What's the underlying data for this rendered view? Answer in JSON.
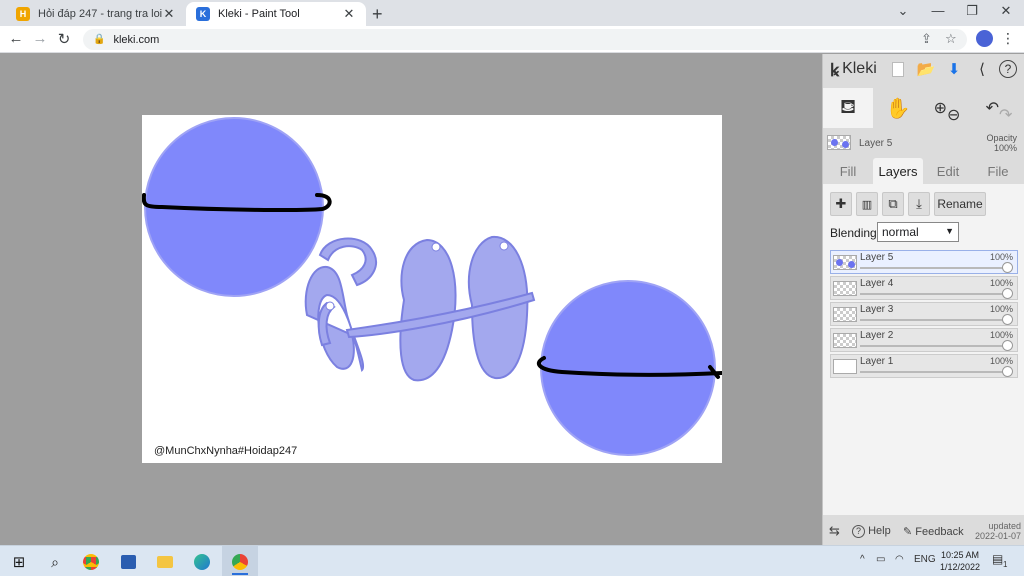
{
  "browser": {
    "tabs": [
      {
        "title": "Hỏi đáp 247 - trang tra loi",
        "favicon": "H",
        "close": "✕"
      },
      {
        "title": "Kleki - Paint Tool",
        "favicon": "K",
        "close": "✕"
      }
    ],
    "new_tab": "+",
    "url": "kleki.com",
    "window": {
      "dropdown": "⌄",
      "minimize": "—",
      "restore": "❐",
      "close": "✕"
    },
    "nav": {
      "back": "←",
      "forward": "→",
      "reload": "↻"
    }
  },
  "canvas": {
    "watermark": "@MunChxNynha#Hoidap247",
    "colors": {
      "circle": "#8088fb",
      "shape": "#a3a8ee",
      "stroke": "#000000"
    }
  },
  "panel": {
    "logo": "Kleki",
    "current_layer": {
      "name": "Layer 5",
      "opacity_label": "Opacity",
      "opacity": "100%"
    },
    "tabs": [
      "Fill",
      "Layers",
      "Edit",
      "File"
    ],
    "active_tab": "Layers",
    "buttons": {
      "add": "✚",
      "delete": "🗑",
      "duplicate": "⧉",
      "merge": "⤓",
      "rename": "Rename"
    },
    "blending": {
      "label": "Blending",
      "value": "normal"
    },
    "layers": [
      {
        "name": "Layer 5",
        "opacity": "100%",
        "selected": true
      },
      {
        "name": "Layer 4",
        "opacity": "100%",
        "selected": false
      },
      {
        "name": "Layer 3",
        "opacity": "100%",
        "selected": false
      },
      {
        "name": "Layer 2",
        "opacity": "100%",
        "selected": false
      },
      {
        "name": "Layer 1",
        "opacity": "100%",
        "selected": false
      }
    ],
    "footer": {
      "help": "Help",
      "feedback": "Feedback",
      "updated_label": "updated",
      "updated_date": "2022-01-07"
    }
  },
  "taskbar": {
    "language": "ENG",
    "time": "10:25 AM",
    "date": "1/12/2022",
    "notification_count": "1"
  }
}
